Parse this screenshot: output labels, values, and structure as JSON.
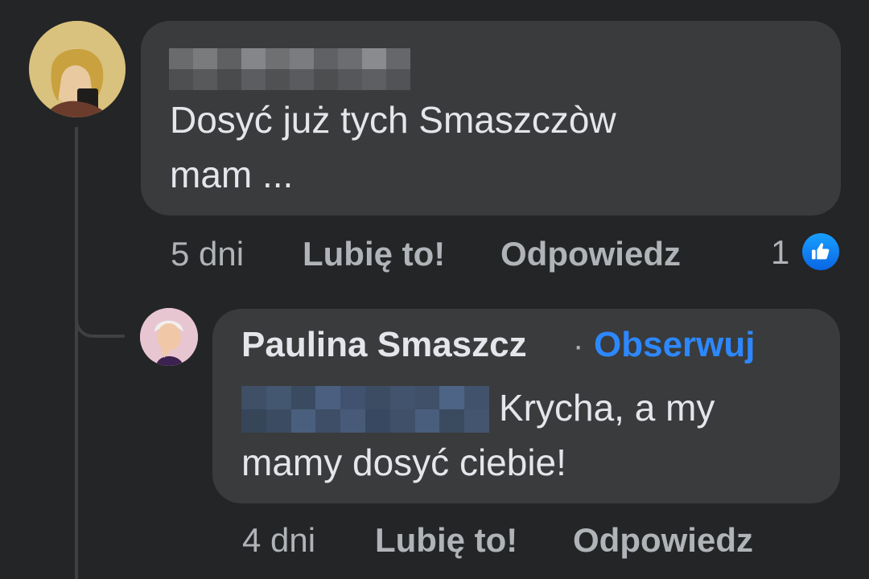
{
  "colors": {
    "background": "#242526",
    "bubble": "#3a3b3c",
    "text_primary": "#e4e6eb",
    "text_secondary": "#b0b3b8",
    "link_blue": "#2d88ff",
    "like_badge": "#1877f2"
  },
  "comments": [
    {
      "author_name_visible": false,
      "text_line_1": "Dosyć już tych Smaszczòw",
      "text_line_2": "mam ...",
      "time": "5 dni",
      "like_label": "Lubię to!",
      "reply_label": "Odpowiedz",
      "reaction_count": "1",
      "reaction_icon": "thumbs-up-icon"
    },
    {
      "author_name": "Paulina Smaszcz",
      "separator": "·",
      "follow_label": "Obserwuj",
      "mention_visible": false,
      "text_line_1": "Krycha, a my",
      "text_line_2": "mamy dosyć ciebie!",
      "time": "4 dni",
      "like_label": "Lubię to!",
      "reply_label": "Odpowiedz"
    }
  ]
}
